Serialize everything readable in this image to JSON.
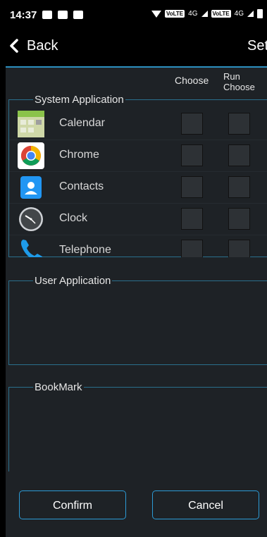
{
  "status": {
    "time": "14:37",
    "network1": "4G",
    "network2": "4G",
    "volte": "VoLTE"
  },
  "toolbar": {
    "back_label": "Back",
    "title": "Set"
  },
  "columns": {
    "choose": "Choose",
    "run_choose": "Run Choose"
  },
  "groups": {
    "system": "System Application",
    "user": "User Application",
    "bookmark": "BookMark"
  },
  "system_apps": [
    {
      "name": "Calendar",
      "icon": "calendar-icon"
    },
    {
      "name": "Chrome",
      "icon": "chrome-icon"
    },
    {
      "name": "Contacts",
      "icon": "contacts-icon"
    },
    {
      "name": "Clock",
      "icon": "clock-icon"
    },
    {
      "name": "Telephone",
      "icon": "telephone-icon"
    }
  ],
  "buttons": {
    "confirm": "Confirm",
    "cancel": "Cancel"
  },
  "colors": {
    "accent": "#2c9bd6",
    "panel": "#1e2226"
  }
}
